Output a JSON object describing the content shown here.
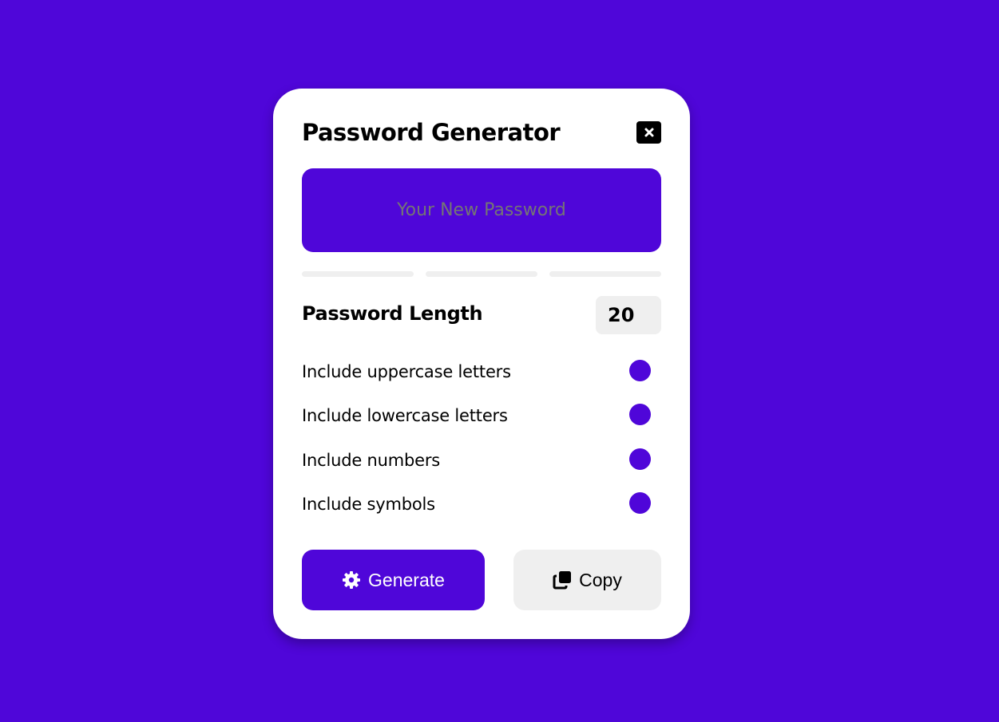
{
  "app": {
    "title": "Password Generator"
  },
  "password": {
    "placeholder": "Your New Password"
  },
  "length": {
    "label": "Password Length",
    "value": "20"
  },
  "options": [
    {
      "label": "Include uppercase letters",
      "checked": true
    },
    {
      "label": "Include lowercase letters",
      "checked": true
    },
    {
      "label": "Include numbers",
      "checked": true
    },
    {
      "label": "Include symbols",
      "checked": true
    }
  ],
  "actions": {
    "generate_label": "Generate",
    "copy_label": "Copy"
  },
  "icons": {
    "close": "close-icon",
    "generate": "gear-icon",
    "copy": "copy-icon"
  },
  "colors": {
    "accent": "#4f06d9",
    "surface": "#ffffff",
    "muted": "#efefef",
    "text": "#000000"
  }
}
